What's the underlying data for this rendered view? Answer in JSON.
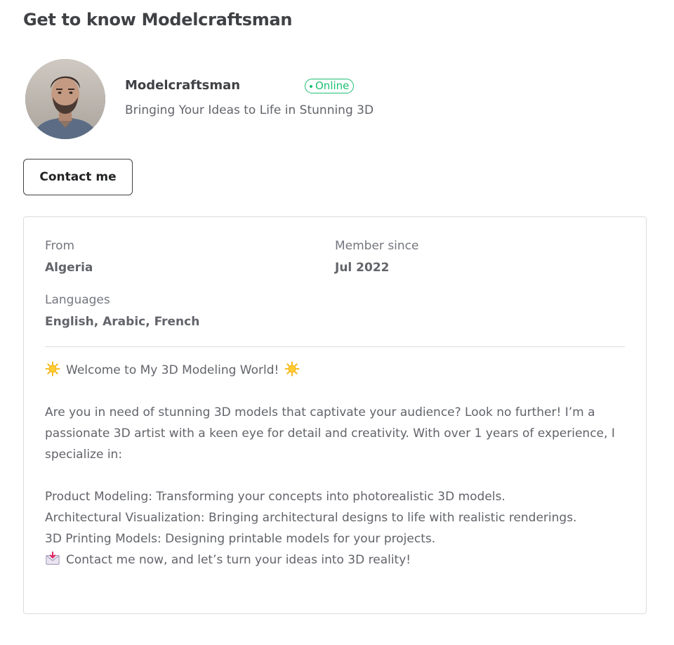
{
  "header": {
    "title": "Get to know Modelcraftsman"
  },
  "profile": {
    "name": "Modelcraftsman",
    "status": "Online",
    "tagline": "Bringing Your Ideas to Life in Stunning 3D",
    "contact_label": "Contact me"
  },
  "stats": {
    "from_label": "From",
    "from_value": "Algeria",
    "member_label": "Member since",
    "member_value": "Jul 2022",
    "languages_label": "Languages",
    "languages_value": "English, Arabic, French"
  },
  "description": {
    "welcome": "Welcome to My 3D Modeling World!",
    "intro": "Are you in need of stunning 3D models that captivate your audience? Look no further! I’m a passionate 3D artist with a keen eye for detail and creativity. With over 1 years of experience, I specialize in:",
    "service_1": "Product Modeling: Transforming your concepts into photorealistic 3D models.",
    "service_2": "Architectural Visualization: Bringing architectural designs to life with realistic renderings.",
    "service_3": "3D Printing Models: Designing printable models for your projects.",
    "cta": "Contact me now, and let’s turn your ideas into 3D reality!"
  },
  "icons": {
    "sun": "sun-icon",
    "envelope": "envelope-download-icon"
  },
  "colors": {
    "online_green": "#1dbf73",
    "text_dark": "#404145",
    "text_muted": "#62646a",
    "border": "#dadbdd"
  }
}
